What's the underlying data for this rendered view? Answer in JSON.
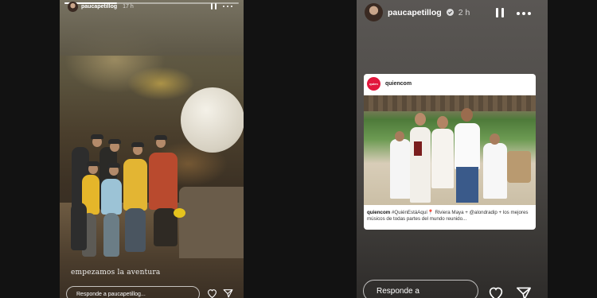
{
  "left_story": {
    "username": "paucapetillog",
    "time": "17 h",
    "caption": "empezamos la aventura",
    "reply_placeholder": "Responde a paucapetillog...",
    "progress": 0.3
  },
  "right_story": {
    "username": "paucapetillog",
    "time": "2 h",
    "reply_placeholder": "Responde a",
    "shared_post": {
      "logo_text": "quien",
      "username": "quiencom",
      "caption_user": "quiencom",
      "caption_text": "#QuiénEstáAquí📍 Riviera Maya + @alondradip + los mejores músicos de todas partes del mundo reunido..."
    }
  },
  "icons": [
    "verified-icon",
    "pause-icon",
    "more-icon",
    "heart-icon",
    "send-icon"
  ],
  "colors": {
    "background": "#121212",
    "brand": "#e2173d"
  }
}
